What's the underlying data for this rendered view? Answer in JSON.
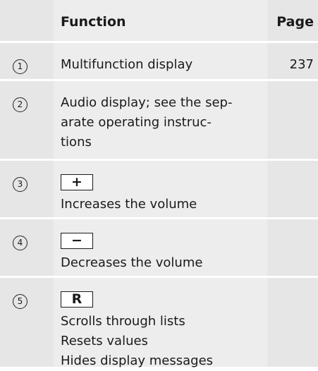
{
  "header": {
    "function": "Function",
    "page": "Page"
  },
  "rows": [
    {
      "num": "1",
      "lines": [
        "Multifunction display"
      ],
      "page": "237"
    },
    {
      "num": "2",
      "lines": [
        "Audio display; see the sep-",
        "arate operating instruc-",
        "tions"
      ],
      "page": ""
    },
    {
      "num": "3",
      "key": "+",
      "lines": [
        "Increases the volume"
      ],
      "page": ""
    },
    {
      "num": "4",
      "key": "−",
      "lines": [
        "Decreases the volume"
      ],
      "page": ""
    },
    {
      "num": "5",
      "key": "R",
      "lines": [
        "Scrolls through lists",
        "Resets values",
        "Hides display messages"
      ],
      "page": ""
    }
  ]
}
